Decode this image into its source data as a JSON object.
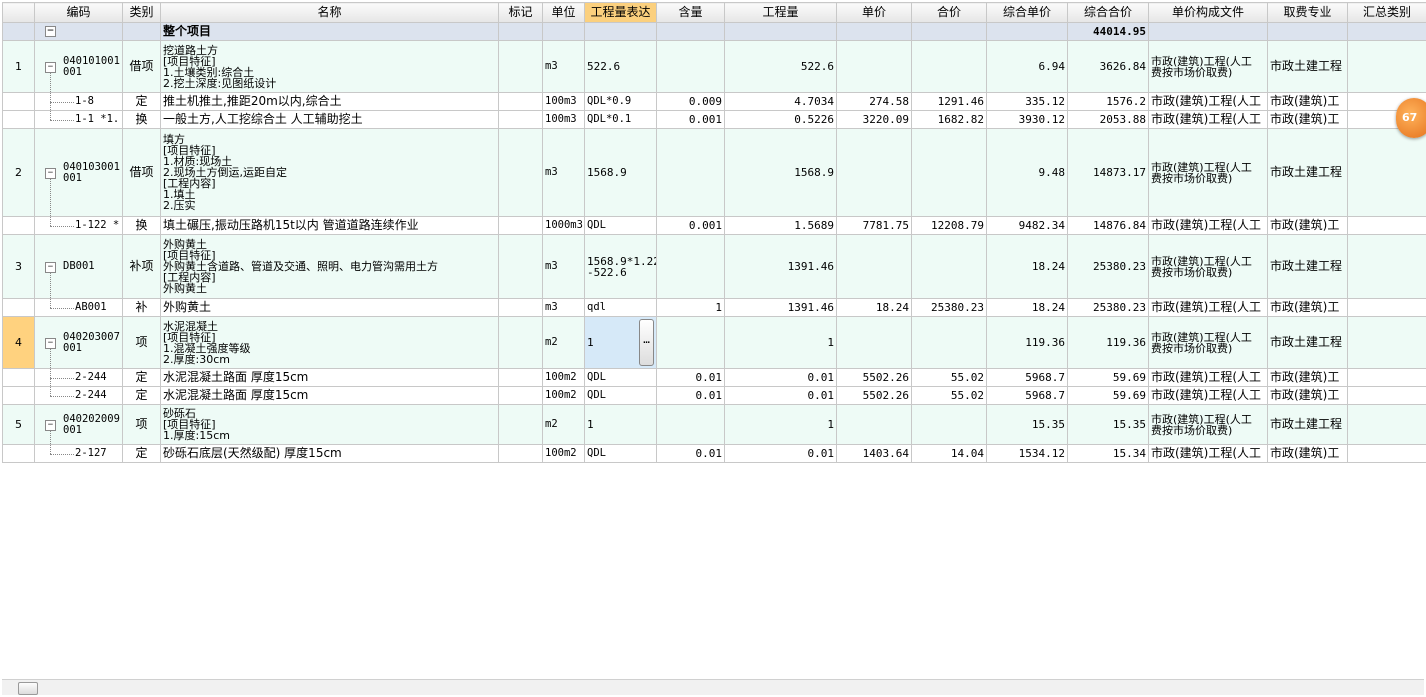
{
  "headers": [
    "编码",
    "类别",
    "名称",
    "标记",
    "单位",
    "工程量表达",
    "含量",
    "工程量",
    "单价",
    "合价",
    "综合单价",
    "综合合价",
    "单价构成文件",
    "取费专业",
    "汇总类别"
  ],
  "active_header": "工程量表达",
  "root": {
    "label": "整个项目",
    "total": "44014.95"
  },
  "items": [
    {
      "num": "1",
      "code": "040101001\n001",
      "type": "借项",
      "name": "挖道路土方\n[项目特征]\n1.土壤类别:综合土\n2.挖土深度:见图纸设计",
      "unit": "m3",
      "expr": "522.6",
      "content": "",
      "qty": "522.6",
      "price": "",
      "amount": "",
      "unit_total": "6.94",
      "total": "3626.84",
      "file": "市政(建筑)工程(人工\n费按市场价取费)",
      "major": "市政土建工程",
      "subs": [
        {
          "code": "1-8",
          "type": "定",
          "name": "推土机推土,推距20m以内,综合土",
          "unit": "100m3",
          "expr": "QDL*0.9",
          "content": "0.009",
          "qty": "4.7034",
          "price": "274.58",
          "amount": "1291.46",
          "unit_total": "335.12",
          "total": "1576.2",
          "file": "市政(建筑)工程(人工",
          "major": "市政(建筑)工"
        },
        {
          "code": "1-1 *1.",
          "type": "换",
          "name": "一般土方,人工挖综合土 人工辅助挖土",
          "unit": "100m3",
          "expr": "QDL*0.1",
          "content": "0.001",
          "qty": "0.5226",
          "price": "3220.09",
          "amount": "1682.82",
          "unit_total": "3930.12",
          "total": "2053.88",
          "file": "市政(建筑)工程(人工",
          "major": "市政(建筑)工"
        }
      ]
    },
    {
      "num": "2",
      "code": "040103001\n001",
      "type": "借项",
      "name": "填方\n[项目特征]\n1.材质:现场土\n2.现场土方倒运,运距自定\n[工程内容]\n1.填土\n2.压实",
      "unit": "m3",
      "expr": "1568.9",
      "content": "",
      "qty": "1568.9",
      "price": "",
      "amount": "",
      "unit_total": "9.48",
      "total": "14873.17",
      "file": "市政(建筑)工程(人工\n费按市场价取费)",
      "major": "市政土建工程",
      "subs": [
        {
          "code": "1-122 *",
          "type": "换",
          "name": "填土碾压,振动压路机15t以内 管道道路连续作业",
          "unit": "1000m3",
          "expr": "QDL",
          "content": "0.001",
          "qty": "1.5689",
          "price": "7781.75",
          "amount": "12208.79",
          "unit_total": "9482.34",
          "total": "14876.84",
          "file": "市政(建筑)工程(人工",
          "major": "市政(建筑)工"
        }
      ]
    },
    {
      "num": "3",
      "code": "DB001",
      "type": "补项",
      "name": "外购黄土\n[项目特征]\n外购黄土含道路、管道及交通、照明、电力管沟需用土方\n[工程内容]\n外购黄土",
      "unit": "m3",
      "expr": "1568.9*1.22\n-522.6",
      "content": "",
      "qty": "1391.46",
      "price": "",
      "amount": "",
      "unit_total": "18.24",
      "total": "25380.23",
      "file": "市政(建筑)工程(人工\n费按市场价取费)",
      "major": "市政土建工程",
      "subs": [
        {
          "code": "AB001",
          "type": "补",
          "name": "外购黄土",
          "unit": "m3",
          "expr": "qdl",
          "content": "1",
          "qty": "1391.46",
          "price": "18.24",
          "amount": "25380.23",
          "unit_total": "18.24",
          "total": "25380.23",
          "file": "市政(建筑)工程(人工",
          "major": "市政(建筑)工"
        }
      ]
    },
    {
      "num": "4",
      "code": "040203007\n001",
      "type": "项",
      "name": "水泥混凝土\n[项目特征]\n1.混凝土强度等级\n2.厚度:30cm",
      "unit": "m2",
      "expr": "1",
      "content": "",
      "qty": "1",
      "price": "",
      "amount": "",
      "unit_total": "119.36",
      "total": "119.36",
      "file": "市政(建筑)工程(人工\n费按市场价取费)",
      "major": "市政土建工程",
      "subs": [
        {
          "code": "2-244",
          "type": "定",
          "name": "水泥混凝土路面 厚度15cm",
          "unit": "100m2",
          "expr": "QDL",
          "content": "0.01",
          "qty": "0.01",
          "price": "5502.26",
          "amount": "55.02",
          "unit_total": "5968.7",
          "total": "59.69",
          "file": "市政(建筑)工程(人工",
          "major": "市政(建筑)工"
        },
        {
          "code": "2-244",
          "type": "定",
          "name": "水泥混凝土路面 厚度15cm",
          "unit": "100m2",
          "expr": "QDL",
          "content": "0.01",
          "qty": "0.01",
          "price": "5502.26",
          "amount": "55.02",
          "unit_total": "5968.7",
          "total": "59.69",
          "file": "市政(建筑)工程(人工",
          "major": "市政(建筑)工"
        }
      ]
    },
    {
      "num": "5",
      "code": "040202009\n001",
      "type": "项",
      "name": "砂砾石\n[项目特征]\n1.厚度:15cm",
      "unit": "m2",
      "expr": "1",
      "content": "",
      "qty": "1",
      "price": "",
      "amount": "",
      "unit_total": "15.35",
      "total": "15.35",
      "file": "市政(建筑)工程(人工\n费按市场价取费)",
      "major": "市政土建工程",
      "subs": [
        {
          "code": "2-127",
          "type": "定",
          "name": "砂砾石底层(天然级配) 厚度15cm",
          "unit": "100m2",
          "expr": "QDL",
          "content": "0.01",
          "qty": "0.01",
          "price": "1403.64",
          "amount": "14.04",
          "unit_total": "1534.12",
          "total": "15.34",
          "file": "市政(建筑)工程(人工",
          "major": "市政(建筑)工"
        }
      ]
    }
  ],
  "float_badge": "67"
}
